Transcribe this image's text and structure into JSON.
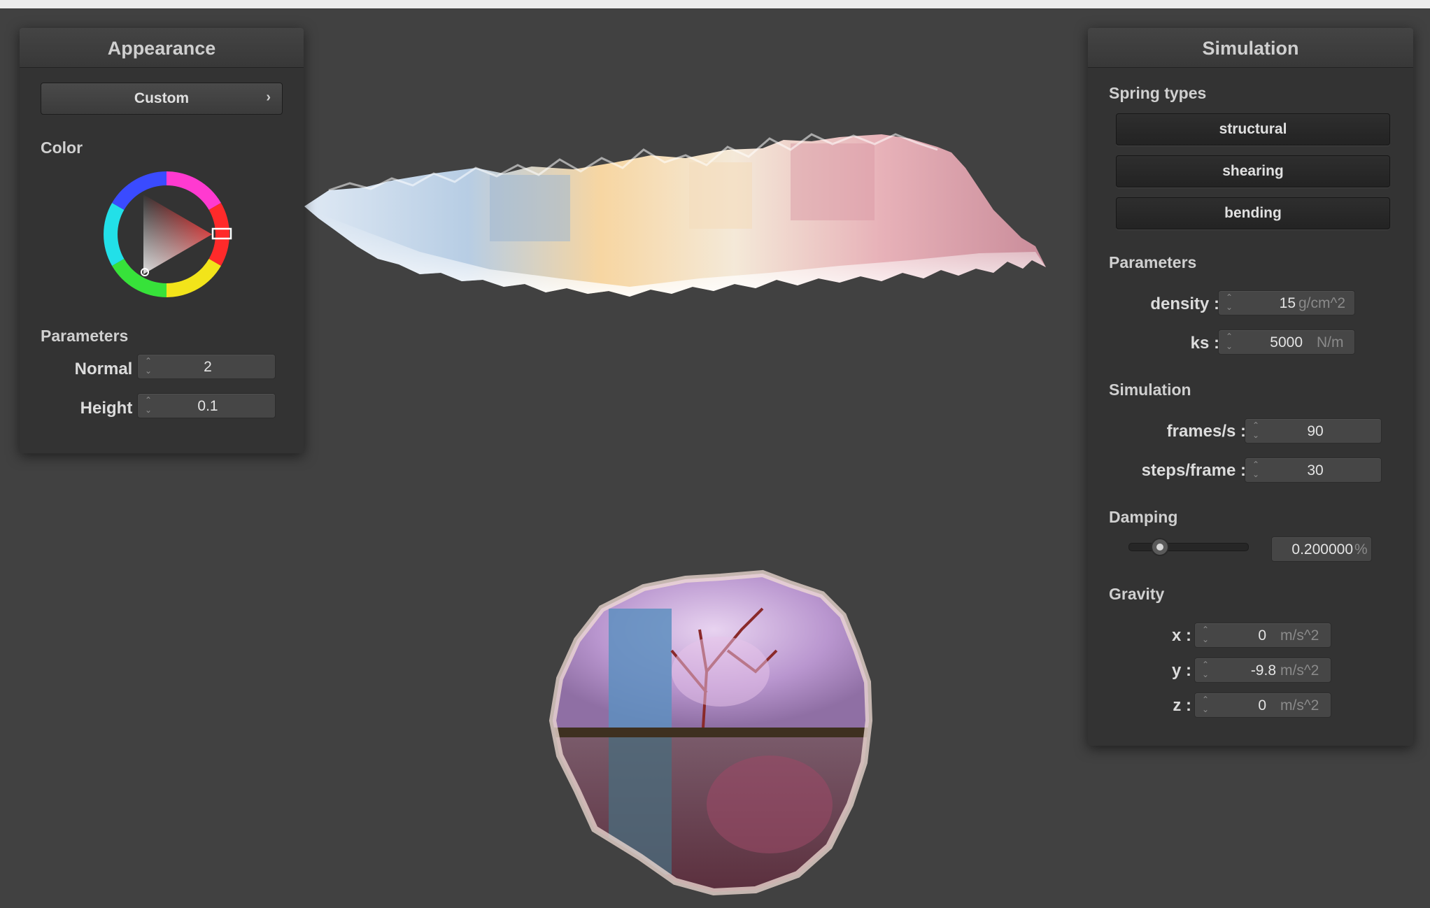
{
  "appearance": {
    "title": "Appearance",
    "preset": "Custom",
    "color_label": "Color",
    "parameters_label": "Parameters",
    "normal_label": "Normal :",
    "normal_value": "2",
    "height_label": "Height :",
    "height_value": "0.1"
  },
  "simulation": {
    "title": "Simulation",
    "spring_types_label": "Spring types",
    "spring_types": [
      "structural",
      "shearing",
      "bending"
    ],
    "parameters_label": "Parameters",
    "density_label": "density :",
    "density_value": "15",
    "density_unit": "g/cm^2",
    "ks_label": "ks :",
    "ks_value": "5000",
    "ks_unit": "N/m",
    "simulation_label": "Simulation",
    "fps_label": "frames/s :",
    "fps_value": "90",
    "steps_label": "steps/frame :",
    "steps_value": "30",
    "damping_label": "Damping",
    "damping_value": "0.200000",
    "damping_unit": "%",
    "damping_fraction": 0.2,
    "gravity_label": "Gravity",
    "gx_label": "x :",
    "gx_value": "0",
    "gy_label": "y :",
    "gy_value": "-9.8",
    "gz_label": "z :",
    "gz_value": "0",
    "gravity_unit": "m/s^2"
  },
  "colors": {
    "background": "#414141",
    "panel": "#333333",
    "selected_color": "#c41e1e"
  }
}
